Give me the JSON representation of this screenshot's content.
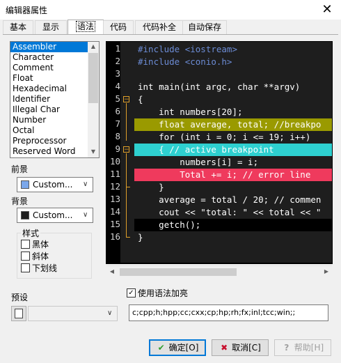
{
  "window": {
    "title": "编辑器属性",
    "close_glyph": "✕"
  },
  "tabs": [
    {
      "label": "基本"
    },
    {
      "label": "显示"
    },
    {
      "label": "语法",
      "active": true
    },
    {
      "label": "代码"
    },
    {
      "label": "代码补全"
    },
    {
      "label": "自动保存"
    }
  ],
  "syntax_list": {
    "items": [
      "Assembler",
      "Character",
      "Comment",
      "Float",
      "Hexadecimal",
      "Identifier",
      "Illegal Char",
      "Number",
      "Octal",
      "Preprocessor",
      "Reserved Word"
    ],
    "selected": "Assembler"
  },
  "foreground": {
    "label": "前景",
    "value": "Custom...",
    "color": "#7ba7ea"
  },
  "background": {
    "label": "背景",
    "value": "Custom...",
    "color": "#1e1e1e"
  },
  "styles": {
    "label": "样式",
    "bold": {
      "label": "黑体",
      "checked": false
    },
    "italic": {
      "label": "斜体",
      "checked": false
    },
    "underline": {
      "label": "下划线",
      "checked": false
    }
  },
  "editor": {
    "line_numbers": [
      "1",
      "2",
      "3",
      "4",
      "5",
      "6",
      "7",
      "8",
      "9",
      "10",
      "11",
      "12",
      "13",
      "14",
      "15",
      "16"
    ],
    "lines": [
      {
        "text": "#include <iostream>",
        "style": "blue"
      },
      {
        "text": "#include <conio.h>",
        "style": "blue"
      },
      {
        "text": "",
        "style": "blue"
      },
      {
        "text": "int main(int argc, char **argv)",
        "style": "white"
      },
      {
        "text": "{",
        "style": "white"
      },
      {
        "text": "    int numbers[20];",
        "style": "white"
      },
      {
        "text": "    float average, total; //breakpo",
        "style": "olive"
      },
      {
        "text": "    for (int i = 0; i <= 19; i++)",
        "style": "white"
      },
      {
        "text": "    { // active breakpoint",
        "style": "cyan"
      },
      {
        "text": "        numbers[i] = i;",
        "style": "white"
      },
      {
        "text": "        Total += i; // error line",
        "style": "red"
      },
      {
        "text": "    }",
        "style": "white"
      },
      {
        "text": "    average = total / 20; // commen",
        "style": "white"
      },
      {
        "text": "    cout << \"total: \" << total << \"",
        "style": "white"
      },
      {
        "text": "    getch();",
        "style": "black"
      },
      {
        "text": "}",
        "style": "white"
      }
    ],
    "fold_marker": "−"
  },
  "preset": {
    "label": "预设",
    "value": ""
  },
  "use_syntax": {
    "label": "使用语法加亮",
    "checked": true
  },
  "extensions": {
    "value": "c;cpp;h;hpp;cc;cxx;cp;hp;rh;fx;inl;tcc;win;;"
  },
  "buttons": {
    "ok": {
      "label": "确定[O]",
      "icon": "✔"
    },
    "cancel": {
      "label": "取消[C]",
      "icon": "✖"
    },
    "help": {
      "label": "帮助[H]",
      "icon": "?"
    }
  },
  "colors": {
    "accent": "#0078d7",
    "olive": "#9a9a00",
    "cyan": "#2ed0d0",
    "red": "#ef3a5d",
    "fold": "#e0a02a"
  }
}
